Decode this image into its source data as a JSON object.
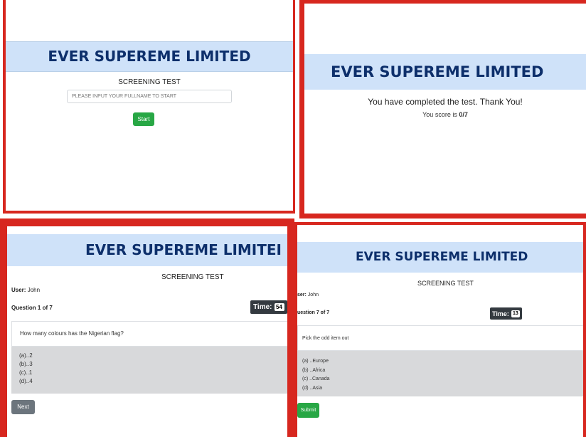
{
  "panel1": {
    "brand": "EVER SUPEREME LIMITED",
    "title": "SCREENING TEST",
    "name_placeholder": "PLEASE INPUT YOUR FULLNAME TO START",
    "start_label": "Start"
  },
  "panel2": {
    "brand": "EVER SUPEREME LIMITED",
    "completed": "You have completed the test. Thank You!",
    "score_prefix": "You score is",
    "score_value": "0/7"
  },
  "panel3": {
    "brand": "EVER SUPEREME LIMITEI",
    "title": "SCREENING TEST",
    "user_label": "User:",
    "user_name": "John",
    "question_counter": "Question 1 of 7",
    "time_label": "Time:",
    "time_value": "54",
    "question": "How many colours has the Nigerian flag?",
    "options": [
      "(a)..2",
      "(b)..3",
      "(c)..1",
      "(d)..4"
    ],
    "next_label": "Next"
  },
  "panel4": {
    "brand": "EVER SUPEREME LIMITED",
    "title": "SCREENING TEST",
    "user_label": "ser:",
    "user_name": "John",
    "question_counter": "uestion 7 of 7",
    "time_label": "Time:",
    "time_value": "13",
    "question": "Pick the odd item out",
    "options": [
      "(a) ..Europe",
      "(b) ..Africa",
      "(c) ..Canada",
      "(d) ..Asia"
    ],
    "submit_label": "Submit"
  },
  "colors": {
    "frame": "#d7271f",
    "banner_bg": "#cfe2f9",
    "brand_text": "#0d2f6b",
    "green": "#28a745",
    "grey": "#6c757d",
    "timer_bg": "#343a40"
  }
}
